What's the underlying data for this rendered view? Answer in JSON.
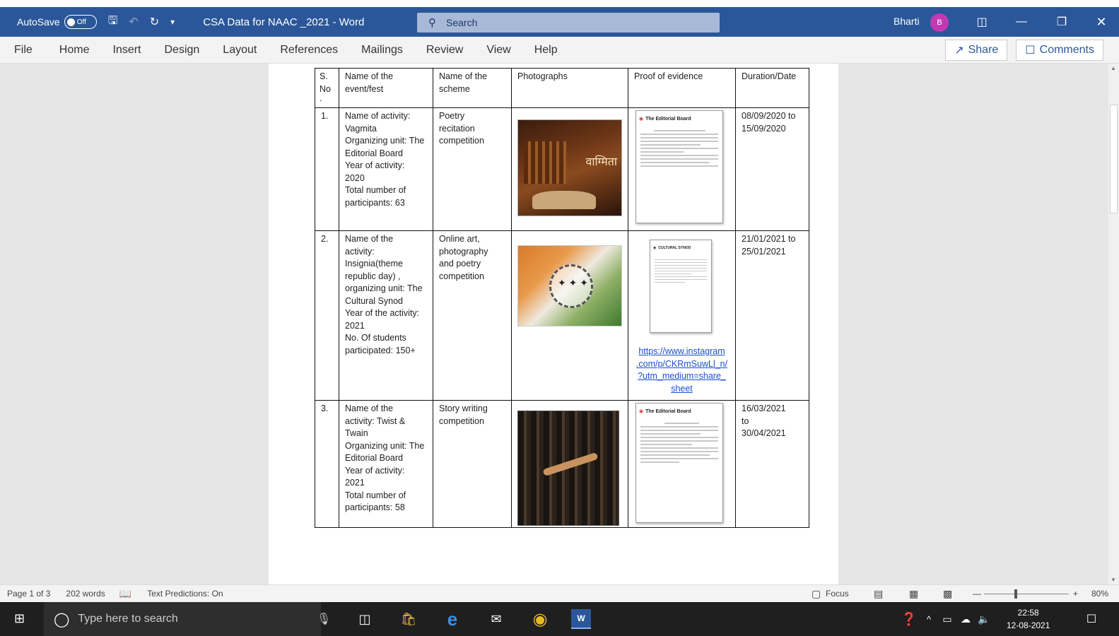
{
  "titlebar": {
    "autosave_label": "AutoSave",
    "autosave_state": "Off",
    "doc_title": "CSA Data for NAAC _2021  -  Word",
    "search_placeholder": "Search",
    "user_name": "Bharti",
    "user_initial": "B"
  },
  "ribbon": {
    "tabs": [
      "File",
      "Home",
      "Insert",
      "Design",
      "Layout",
      "References",
      "Mailings",
      "Review",
      "View",
      "Help"
    ],
    "share_label": "Share",
    "comments_label": "Comments"
  },
  "table": {
    "headers": [
      "S. No",
      "Name of the event/fest",
      "Name of the scheme",
      "Photographs",
      "Proof of evidence",
      "Duration/Date"
    ],
    "header_dot": ".",
    "rows": [
      {
        "sno": "1.",
        "event_lines": [
          "Name of activity:",
          "Vagmita",
          "Organizing unit: The",
          "Editorial Board",
          "Year of activity:",
          "2020",
          "Total number of",
          "participants: 63"
        ],
        "scheme_lines": [
          " Poetry",
          "recitation",
          "competition"
        ],
        "photo_caption": "वाग्मिता",
        "proof_header": "The Editorial Board",
        "date_lines": [
          "08/09/2020 to",
          "15/09/2020"
        ]
      },
      {
        "sno": "2.",
        "event_lines": [
          "Name of the",
          "activity:",
          "Insignia(theme",
          "republic day) ,",
          "organizing unit: The",
          "Cultural Synod",
          "Year of the activity:",
          "2021",
          "No. Of students",
          "participated: 150+"
        ],
        "scheme_lines": [
          "Online art,",
          "photography",
          "and poetry",
          "competition"
        ],
        "proof_header": "CULTURAL SYNOD",
        "link_lines": [
          "https://www.instagram",
          ".com/p/CKRmSuwLl_n/",
          "?utm_medium=share_",
          "sheet"
        ],
        "date_lines": [
          "21/01/2021 to",
          "25/01/2021"
        ]
      },
      {
        "sno": "3.",
        "event_lines": [
          "Name of the",
          "activity: Twist &",
          "Twain",
          "Organizing unit: The",
          "Editorial Board",
          "Year of activity:",
          "2021",
          "Total number of",
          "participants: 58"
        ],
        "scheme_lines": [
          " Story writing",
          "competition"
        ],
        "proof_header": "The Editorial Board",
        "date_lines": [
          "16/03/2021",
          "to",
          "30/04/2021"
        ]
      }
    ]
  },
  "statusbar": {
    "page": "Page 1 of 3",
    "words": "202 words",
    "predictions": "Text Predictions: On",
    "focus": "Focus",
    "zoom": "80%"
  },
  "taskbar": {
    "search_placeholder": "Type here to search",
    "time": "22:58",
    "date": "12-08-2021"
  },
  "colors": {
    "word_blue": "#2b579a",
    "avatar": "#c239b3",
    "taskbar": "#1f1f1f"
  }
}
